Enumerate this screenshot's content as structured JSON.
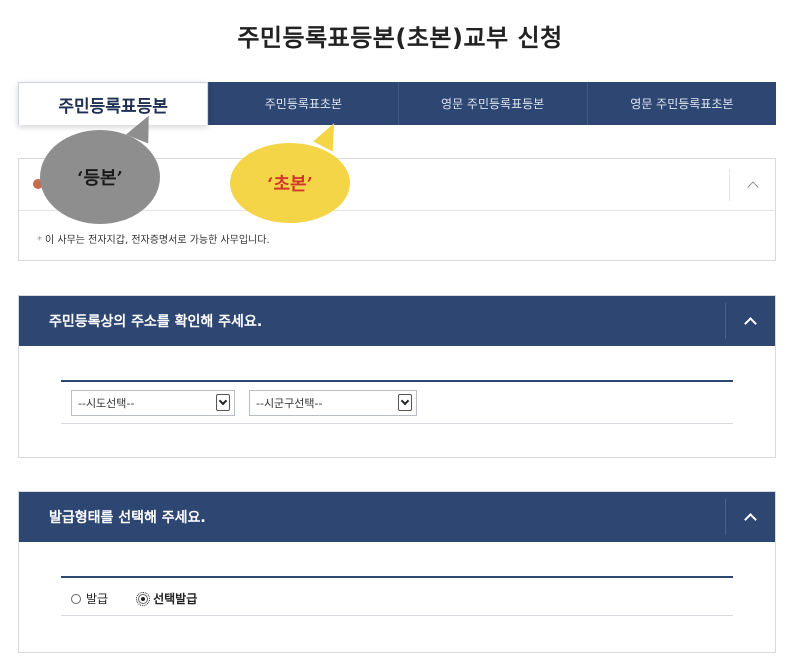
{
  "page_title": "주민등록표등본(초본)교부 신청",
  "tabs": [
    {
      "label": "주민등록표등본",
      "active": true
    },
    {
      "label": "주민등록표초본",
      "active": false
    },
    {
      "label": "영문 주민등록표등본",
      "active": false
    },
    {
      "label": "영문 주민등록표초본",
      "active": false
    }
  ],
  "info_box": {
    "notice": "이 사무는 전자지갑, 전자증명서로 가능한 사무입니다.",
    "bullet": "*"
  },
  "address_section": {
    "title": "주민등록상의 주소를 확인해 주세요.",
    "province_select": "--시도선택--",
    "district_select": "--시군구선택--"
  },
  "issue_section": {
    "title": "발급형태를 선택해 주세요.",
    "options": [
      {
        "label": "발급",
        "checked": false
      },
      {
        "label": "선택발급",
        "checked": true
      }
    ]
  },
  "annotations": {
    "gray_bubble": "‘등본’",
    "yellow_bubble": "‘초본’"
  },
  "colors": {
    "navy": "#2e4672",
    "annotation_gray": "#8e8e8e",
    "annotation_yellow": "#f4d548",
    "annotation_red_text": "#d2372b"
  }
}
